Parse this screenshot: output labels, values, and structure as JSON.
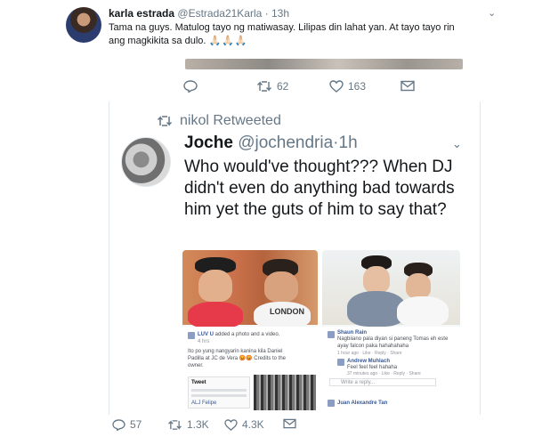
{
  "outer_tweet": {
    "name": "karla estrada",
    "handle": "@Estrada21Karla",
    "separator": "·",
    "time": "13h",
    "text": "Tama na guys. Matulog tayo ng matiwasay. Lilipas din lahat yan. At tayo tayo rin ang magkikita sa dulo.",
    "emoji": "🙏🏻🙏🏻🙏🏻",
    "actions": {
      "replies": "",
      "retweets": "62",
      "likes": "163"
    }
  },
  "retweet_banner": {
    "label": "nikol Retweeted"
  },
  "inner_tweet": {
    "name": "Joche",
    "handle": "@jochendria",
    "separator": "·",
    "time": "1h",
    "text": "Who would've thought??? When DJ didn't even do anything bad towards him yet the guts of him to say that?",
    "media_left": {
      "shirt_text": "LONDON",
      "post_author": "LUV U",
      "post_action": "added a photo and a video.",
      "post_meta": "4 hrs",
      "post_text": "Ito po yung nangyarin kanina kila Daniel Padilla at JC de Vera 😡😡 Credits to the owner.",
      "feed_tweet_label": "Tweet",
      "feed_name": "ALJ Felipe"
    },
    "media_right": {
      "c1_name": "Shaun Rain",
      "c1_text": "Nagbiiano pala diyan si paneng Tomas eh este ayay falcon paka hahahahaha",
      "c1_meta": "1 hour ago · Like · Reply · Share",
      "c2_name": "Andrew Muhlach",
      "c2_text": "Feel feel feel hahaha",
      "c2_meta": "37 minutes ago · Like · Reply · Share",
      "reply_placeholder": "Write a reply...",
      "c3_name": "Juan Alexandre Tan"
    },
    "actions": {
      "replies": "57",
      "retweets": "1.3K",
      "likes": "4.3K"
    }
  },
  "colors": {
    "text": "#14171a",
    "muted": "#657786",
    "border": "#e1e8ed",
    "fb_blue": "#365899"
  }
}
